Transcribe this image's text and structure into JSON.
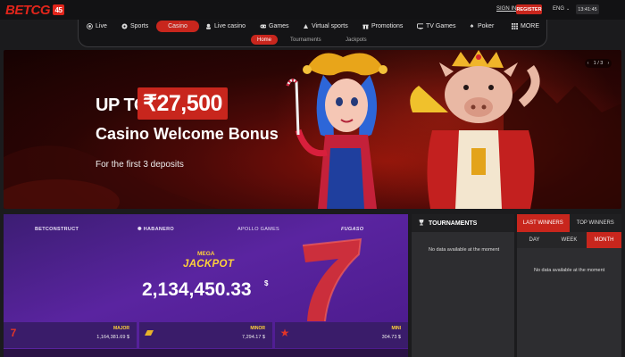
{
  "brand": {
    "name": "BETCG",
    "badge": "45"
  },
  "header": {
    "signin": "SIGN IN",
    "register": "REGISTER",
    "language": "ENG",
    "time": "13:41:45"
  },
  "nav": {
    "items": [
      {
        "label": "Live",
        "icon": "live-dot-icon"
      },
      {
        "label": "Sports",
        "icon": "ball-icon"
      },
      {
        "label": "Casino",
        "icon": "casino-icon"
      },
      {
        "label": "Live casino",
        "icon": "live-casino-icon"
      },
      {
        "label": "Games",
        "icon": "gamepad-icon"
      },
      {
        "label": "Virtual sports",
        "icon": "virtual-sports-icon"
      },
      {
        "label": "Promotions",
        "icon": "gift-icon"
      },
      {
        "label": "TV Games",
        "icon": "tv-icon"
      },
      {
        "label": "Poker",
        "icon": "spade-icon"
      },
      {
        "label": "MORE",
        "icon": "grid-icon"
      }
    ],
    "active": "Casino",
    "sub": [
      "Home",
      "Tournaments",
      "Jackpots"
    ],
    "active_sub": "Home"
  },
  "banner": {
    "upto": "UP TO",
    "amount": "₹27,500",
    "title": "Casino Welcome Bonus",
    "subtitle": "For the first 3 deposits",
    "pager": {
      "current": "1 / 3"
    }
  },
  "jackpot": {
    "providers": [
      "BETCONSTRUCT",
      "HABANERO",
      "APOLLO GAMES",
      "FUGASO"
    ],
    "mega_label": "MEGA",
    "title": "JACKPOT",
    "amount": "2,134,450.33",
    "currency": "$",
    "tiers": [
      {
        "name": "MAJOR",
        "value": "1,164,381.69 $"
      },
      {
        "name": "MINOR",
        "value": "7,294.17 $"
      },
      {
        "name": "MINI",
        "value": "304.73 $"
      }
    ]
  },
  "tournaments": {
    "title": "TOURNAMENTS",
    "empty": "No data available at the moment"
  },
  "winners": {
    "tabs": [
      "LAST WINNERS",
      "TOP WINNERS"
    ],
    "active_tab": "LAST WINNERS",
    "periods": [
      "DAY",
      "WEEK",
      "MONTH"
    ],
    "active_period": "MONTH",
    "empty": "No data available at the moment"
  },
  "colors": {
    "accent": "#c8261d",
    "jackpot_bg": "#5a24a0",
    "gold": "#ffd23a"
  }
}
